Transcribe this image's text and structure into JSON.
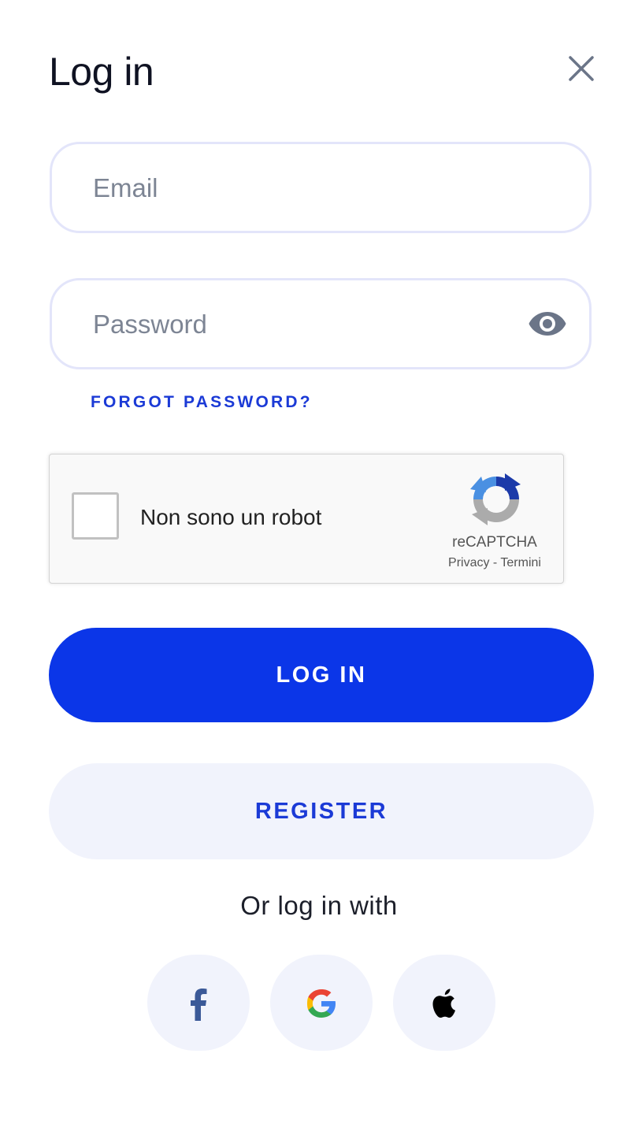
{
  "header": {
    "title": "Log in",
    "close_icon": "close-icon"
  },
  "form": {
    "email_placeholder": "Email",
    "email_value": "",
    "password_placeholder": "Password",
    "password_value": "",
    "password_toggle_icon": "eye-icon",
    "forgot_password": "FORGOT PASSWORD?"
  },
  "recaptcha": {
    "label": "Non sono un robot",
    "checked": false,
    "brand": "reCAPTCHA",
    "privacy": "Privacy",
    "separator": "-",
    "terms": "Termini"
  },
  "actions": {
    "login_label": "LOG IN",
    "register_label": "REGISTER"
  },
  "social": {
    "heading": "Or log in with",
    "providers": [
      {
        "name": "facebook",
        "icon": "facebook-icon"
      },
      {
        "name": "google",
        "icon": "google-icon"
      },
      {
        "name": "apple",
        "icon": "apple-icon"
      }
    ]
  },
  "colors": {
    "primary": "#0b36e8",
    "link": "#1b3ad6",
    "secondary_bg": "#f1f3fc",
    "field_border": "#e3e5fa",
    "placeholder": "#7d8594",
    "facebook": "#3b5998"
  }
}
